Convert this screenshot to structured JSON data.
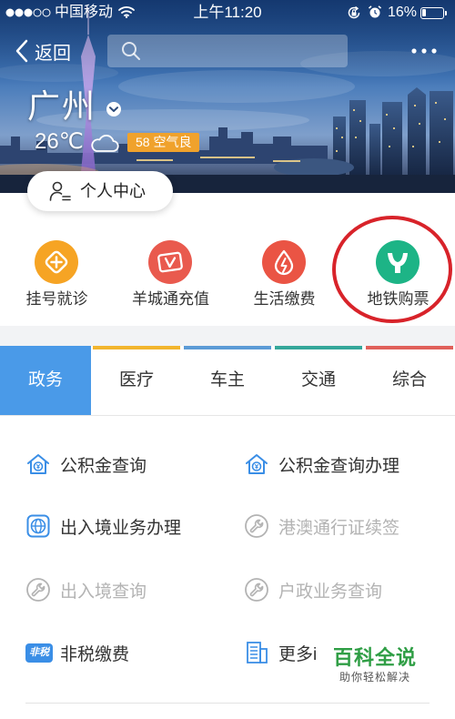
{
  "status_bar": {
    "signal_strength": 3,
    "signal_max": 5,
    "carrier": "中国移动",
    "wifi_icon": "wifi-icon",
    "time": "上午11:20",
    "rotation_lock_icon": "rotation-lock-icon",
    "alarm_icon": "alarm-icon",
    "battery": "16%"
  },
  "nav": {
    "back_label": "返回",
    "back_icon": "chevron-left-icon",
    "search_icon": "search-icon",
    "more_icon": "more-icon"
  },
  "city": {
    "name": "广州",
    "switch_icon": "chevron-down-icon",
    "temperature": "26℃",
    "weather_icon": "cloud-icon",
    "aqi_badge": "58 空气良",
    "aqi_color": "#f0a22c"
  },
  "profile": {
    "label": "个人中心",
    "icon": "person-icon"
  },
  "quick_services": [
    {
      "label": "挂号就诊",
      "icon": "hospital-registration-icon",
      "color": "#f6a424"
    },
    {
      "label": "羊城通充值",
      "icon": "transit-card-icon",
      "color": "#e95a4e"
    },
    {
      "label": "生活缴费",
      "icon": "utility-bill-icon",
      "color": "#ea5444"
    },
    {
      "label": "地铁购票",
      "icon": "metro-icon",
      "color": "#1db486",
      "highlighted": true
    }
  ],
  "annotation_color": "#d8232a",
  "tabs": [
    {
      "label": "政务",
      "selected": true,
      "accent": "#4a9ae8"
    },
    {
      "label": "医疗",
      "selected": false,
      "accent": "#f2b52e"
    },
    {
      "label": "车主",
      "selected": false,
      "accent": "#5c9bd6"
    },
    {
      "label": "交通",
      "selected": false,
      "accent": "#35a79a"
    },
    {
      "label": "综合",
      "selected": false,
      "accent": "#e0605a"
    }
  ],
  "theme": {
    "icon_blue": "#3a8ee6",
    "disabled_gray": "#b3b3b3"
  },
  "services": [
    {
      "label": "公积金查询",
      "icon": "housing-fund-icon",
      "disabled": false
    },
    {
      "label": "公积金查询办理",
      "icon": "housing-fund-icon",
      "disabled": false
    },
    {
      "label": "出入境业务办理",
      "icon": "globe-icon",
      "disabled": false
    },
    {
      "label": "港澳通行证续签",
      "icon": "wrench-icon",
      "disabled": true
    },
    {
      "label": "出入境查询",
      "icon": "wrench-icon",
      "disabled": true
    },
    {
      "label": "户政业务查询",
      "icon": "wrench-icon",
      "disabled": true
    },
    {
      "label": "非税缴费",
      "icon": "non-tax-icon",
      "icon_text": "非税",
      "disabled": false
    },
    {
      "label": "更多i",
      "icon": "building-list-icon",
      "disabled": false
    }
  ],
  "watermark": {
    "title": "百科全说",
    "subtitle": "助你轻松解决",
    "color": "#2f9e45"
  }
}
